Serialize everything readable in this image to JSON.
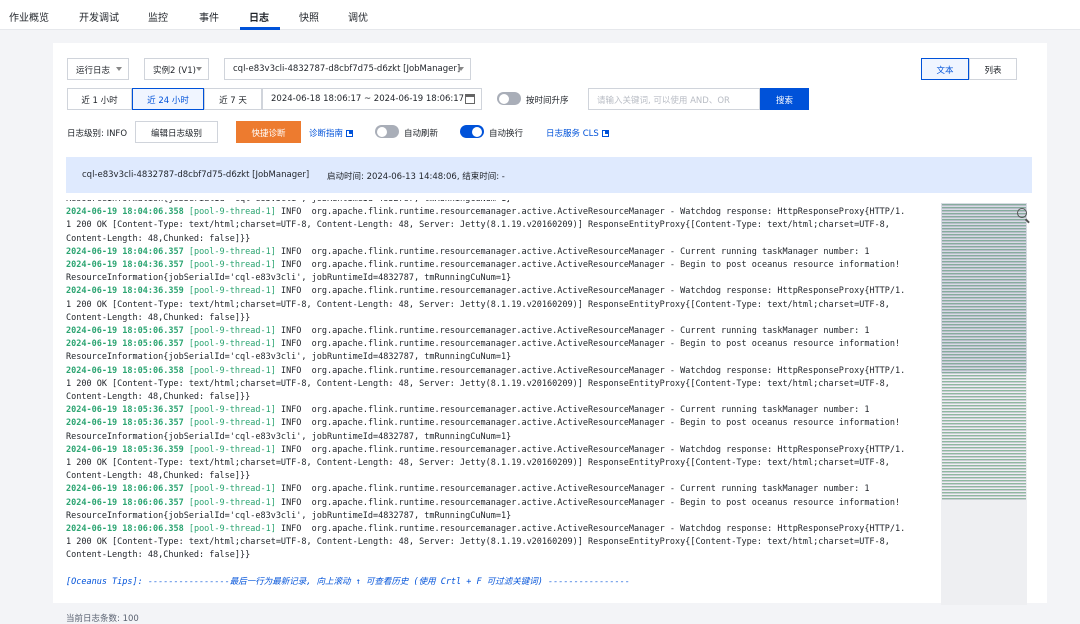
{
  "nav": {
    "tabs": [
      "作业概览",
      "开发调试",
      "监控",
      "事件",
      "日志",
      "快照",
      "调优"
    ],
    "active": "日志"
  },
  "filters": {
    "log_type": "运行日志",
    "instance": "实例2 (V1)",
    "job_manager": "cql-e83v3cli-4832787-d8cbf7d75-d6zkt [JobManager]",
    "view_text": "文本",
    "view_list": "列表",
    "time_1h": "近 1 小时",
    "time_24h": "近 24 小时",
    "time_7d": "近 7 天",
    "date_range": "2024-06-18 18:06:17  ~ 2024-06-19 18:06:17",
    "sort_label": "按时间升序",
    "keyword_placeholder": "请输入关键词, 可以使用 AND、OR",
    "search_button": "搜索",
    "log_level": "日志级别: INFO",
    "edit_level": "编辑日志级别",
    "quick_diagnose": "快捷诊断",
    "diagnose_guide": "诊断指南",
    "auto_refresh": "自动刷新",
    "auto_wrap": "自动换行",
    "cls_link": "日志服务 CLS"
  },
  "toggles": {
    "sort_asc": false,
    "auto_refresh": false,
    "auto_wrap": true
  },
  "colors": {
    "accent": "#0052d9",
    "orange": "#ed7b2f",
    "timestamp": "#2ba471"
  },
  "banner": {
    "job": "cql-e83v3cli-4832787-d8cbf7d75-d6zkt [JobManager]",
    "start": "启动时间:  2024-06-13 14:48:06, 结束时间:  -"
  },
  "log": {
    "first_partial": "ResourceInformation{jobSerialId='cql-e83v3cli', jobRuntimeId=4832787, tmRunningCuNum=1}",
    "entries": [
      {
        "ts": "2024-06-19 18:04:06.358",
        "thread": "[pool-9-thread-1]",
        "body": " INFO  org.apache.flink.runtime.resourcemanager.active.ActiveResourceManager - Watchdog response: HttpResponseProxy{HTTP/1.",
        "cont": [
          "1 200 OK [Content-Type: text/html;charset=UTF-8, Content-Length: 48, Server: Jetty(8.1.19.v20160209)] ResponseEntityProxy{[Content-Type: text/html;charset=UTF-8,",
          "Content-Length: 48,Chunked: false]}}"
        ]
      },
      {
        "ts": "2024-06-19 18:04:06.357",
        "thread": "[pool-9-thread-1]",
        "body": " INFO  org.apache.flink.runtime.resourcemanager.active.ActiveResourceManager - Current running taskManager number: 1",
        "cont": []
      },
      {
        "ts": "2024-06-19 18:04:36.357",
        "thread": "[pool-9-thread-1]",
        "body": " INFO  org.apache.flink.runtime.resourcemanager.active.ActiveResourceManager - Begin to post oceanus resource information!",
        "cont": [
          "ResourceInformation{jobSerialId='cql-e83v3cli', jobRuntimeId=4832787, tmRunningCuNum=1}"
        ]
      },
      {
        "ts": "2024-06-19 18:04:36.359",
        "thread": "[pool-9-thread-1]",
        "body": " INFO  org.apache.flink.runtime.resourcemanager.active.ActiveResourceManager - Watchdog response: HttpResponseProxy{HTTP/1.",
        "cont": [
          "1 200 OK [Content-Type: text/html;charset=UTF-8, Content-Length: 48, Server: Jetty(8.1.19.v20160209)] ResponseEntityProxy{[Content-Type: text/html;charset=UTF-8,",
          "Content-Length: 48,Chunked: false]}}"
        ]
      },
      {
        "ts": "2024-06-19 18:05:06.357",
        "thread": "[pool-9-thread-1]",
        "body": " INFO  org.apache.flink.runtime.resourcemanager.active.ActiveResourceManager - Current running taskManager number: 1",
        "cont": []
      },
      {
        "ts": "2024-06-19 18:05:06.357",
        "thread": "[pool-9-thread-1]",
        "body": " INFO  org.apache.flink.runtime.resourcemanager.active.ActiveResourceManager - Begin to post oceanus resource information!",
        "cont": [
          "ResourceInformation{jobSerialId='cql-e83v3cli', jobRuntimeId=4832787, tmRunningCuNum=1}"
        ]
      },
      {
        "ts": "2024-06-19 18:05:06.358",
        "thread": "[pool-9-thread-1]",
        "body": " INFO  org.apache.flink.runtime.resourcemanager.active.ActiveResourceManager - Watchdog response: HttpResponseProxy{HTTP/1.",
        "cont": [
          "1 200 OK [Content-Type: text/html;charset=UTF-8, Content-Length: 48, Server: Jetty(8.1.19.v20160209)] ResponseEntityProxy{[Content-Type: text/html;charset=UTF-8,",
          "Content-Length: 48,Chunked: false]}}"
        ]
      },
      {
        "ts": "2024-06-19 18:05:36.357",
        "thread": "[pool-9-thread-1]",
        "body": " INFO  org.apache.flink.runtime.resourcemanager.active.ActiveResourceManager - Current running taskManager number: 1",
        "cont": []
      },
      {
        "ts": "2024-06-19 18:05:36.357",
        "thread": "[pool-9-thread-1]",
        "body": " INFO  org.apache.flink.runtime.resourcemanager.active.ActiveResourceManager - Begin to post oceanus resource information!",
        "cont": [
          "ResourceInformation{jobSerialId='cql-e83v3cli', jobRuntimeId=4832787, tmRunningCuNum=1}"
        ]
      },
      {
        "ts": "2024-06-19 18:05:36.359",
        "thread": "[pool-9-thread-1]",
        "body": " INFO  org.apache.flink.runtime.resourcemanager.active.ActiveResourceManager - Watchdog response: HttpResponseProxy{HTTP/1.",
        "cont": [
          "1 200 OK [Content-Type: text/html;charset=UTF-8, Content-Length: 48, Server: Jetty(8.1.19.v20160209)] ResponseEntityProxy{[Content-Type: text/html;charset=UTF-8,",
          "Content-Length: 48,Chunked: false]}}"
        ]
      },
      {
        "ts": "2024-06-19 18:06:06.357",
        "thread": "[pool-9-thread-1]",
        "body": " INFO  org.apache.flink.runtime.resourcemanager.active.ActiveResourceManager - Current running taskManager number: 1",
        "cont": []
      },
      {
        "ts": "2024-06-19 18:06:06.357",
        "thread": "[pool-9-thread-1]",
        "body": " INFO  org.apache.flink.runtime.resourcemanager.active.ActiveResourceManager - Begin to post oceanus resource information!",
        "cont": [
          "ResourceInformation{jobSerialId='cql-e83v3cli', jobRuntimeId=4832787, tmRunningCuNum=1}"
        ]
      },
      {
        "ts": "2024-06-19 18:06:06.358",
        "thread": "[pool-9-thread-1]",
        "body": " INFO  org.apache.flink.runtime.resourcemanager.active.ActiveResourceManager - Watchdog response: HttpResponseProxy{HTTP/1.",
        "cont": [
          "1 200 OK [Content-Type: text/html;charset=UTF-8, Content-Length: 48, Server: Jetty(8.1.19.v20160209)] ResponseEntityProxy{[Content-Type: text/html;charset=UTF-8,",
          "Content-Length: 48,Chunked: false]}}"
        ]
      }
    ],
    "tips": "[Oceanus Tips]: ----------------最后一行为最新记录, 向上滚动 ↑ 可查看历史 (使用 Crtl + F 可过滤关键词) ----------------"
  },
  "footer": {
    "count": "当前日志条数: 100"
  }
}
